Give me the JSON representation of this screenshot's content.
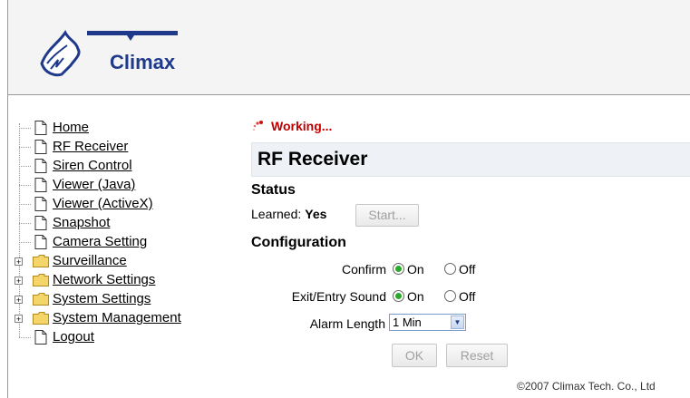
{
  "brand": {
    "logo_text": "Climax"
  },
  "nav": {
    "items": [
      {
        "label": "Home",
        "type": "doc"
      },
      {
        "label": "RF Receiver",
        "type": "doc"
      },
      {
        "label": "Siren Control",
        "type": "doc"
      },
      {
        "label": "Viewer (Java)",
        "type": "doc"
      },
      {
        "label": "Viewer (ActiveX)",
        "type": "doc"
      },
      {
        "label": "Snapshot",
        "type": "doc"
      },
      {
        "label": "Camera Setting",
        "type": "doc"
      },
      {
        "label": "Surveillance",
        "type": "folder"
      },
      {
        "label": "Network Settings",
        "type": "folder"
      },
      {
        "label": "System Settings",
        "type": "folder"
      },
      {
        "label": "System Management",
        "type": "folder"
      },
      {
        "label": "Logout",
        "type": "doc"
      }
    ]
  },
  "status_indicator": {
    "text": "Working..."
  },
  "page": {
    "title": "RF Receiver"
  },
  "status": {
    "heading": "Status",
    "learned_label": "Learned:",
    "learned_value": "Yes",
    "start_button": "Start..."
  },
  "configuration": {
    "heading": "Configuration",
    "confirm": {
      "label": "Confirm",
      "on_label": "On",
      "off_label": "Off",
      "selected": "On"
    },
    "exit_entry_sound": {
      "label": "Exit/Entry Sound",
      "on_label": "On",
      "off_label": "Off",
      "selected": "On"
    },
    "alarm_length": {
      "label": "Alarm Length",
      "value": "1 Min"
    },
    "ok_button": "OK",
    "reset_button": "Reset"
  },
  "footer": {
    "copyright": "©2007 Climax Tech. Co., Ltd"
  },
  "colors": {
    "working_text": "#c00000",
    "radio_selected": "#2ca82c",
    "logo_text": "#1f3a8a"
  }
}
